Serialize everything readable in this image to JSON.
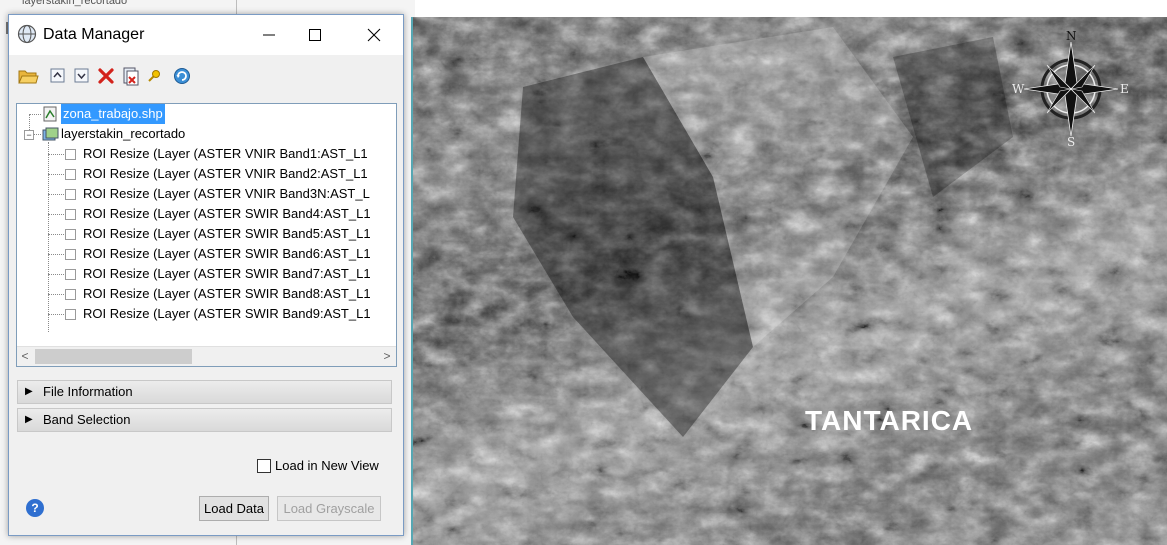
{
  "background": {
    "breadcrumb": "layerstakin_recortado"
  },
  "window": {
    "title": "Data Manager",
    "controls": {
      "minimize": "—",
      "maximize": "☐",
      "close": "✕"
    }
  },
  "toolbar": {
    "icons": [
      "open-folder-icon",
      "collapse-all-icon",
      "expand-all-icon",
      "remove-icon",
      "remove-all-icon",
      "pin-icon",
      "refresh-icon"
    ]
  },
  "tree": {
    "shapefile": "zona_trabajo.shp",
    "raster": "layerstakin_recortado",
    "bands": [
      "ROI Resize (Layer (ASTER VNIR Band1:AST_L1",
      "ROI Resize (Layer (ASTER VNIR Band2:AST_L1",
      "ROI Resize (Layer (ASTER VNIR Band3N:AST_L",
      "ROI Resize (Layer (ASTER SWIR Band4:AST_L1",
      "ROI Resize (Layer (ASTER SWIR Band5:AST_L1",
      "ROI Resize (Layer (ASTER SWIR Band6:AST_L1",
      "ROI Resize (Layer (ASTER SWIR Band7:AST_L1",
      "ROI Resize (Layer (ASTER SWIR Band8:AST_L1",
      "ROI Resize (Layer (ASTER SWIR Band9:AST_L1"
    ]
  },
  "sections": {
    "file_information": "File Information",
    "band_selection": "Band Selection"
  },
  "options": {
    "load_new_view": "Load in New View"
  },
  "buttons": {
    "help": "?",
    "load_data": "Load Data",
    "load_grayscale": "Load Grayscale"
  },
  "image": {
    "place_label": "TANTARICA",
    "compass": {
      "n": "N",
      "s": "S",
      "e": "E",
      "w": "W"
    }
  },
  "colors": {
    "selection": "#3399ff",
    "window_border": "#7a9bc4",
    "image_edge": "#57a7b3"
  }
}
